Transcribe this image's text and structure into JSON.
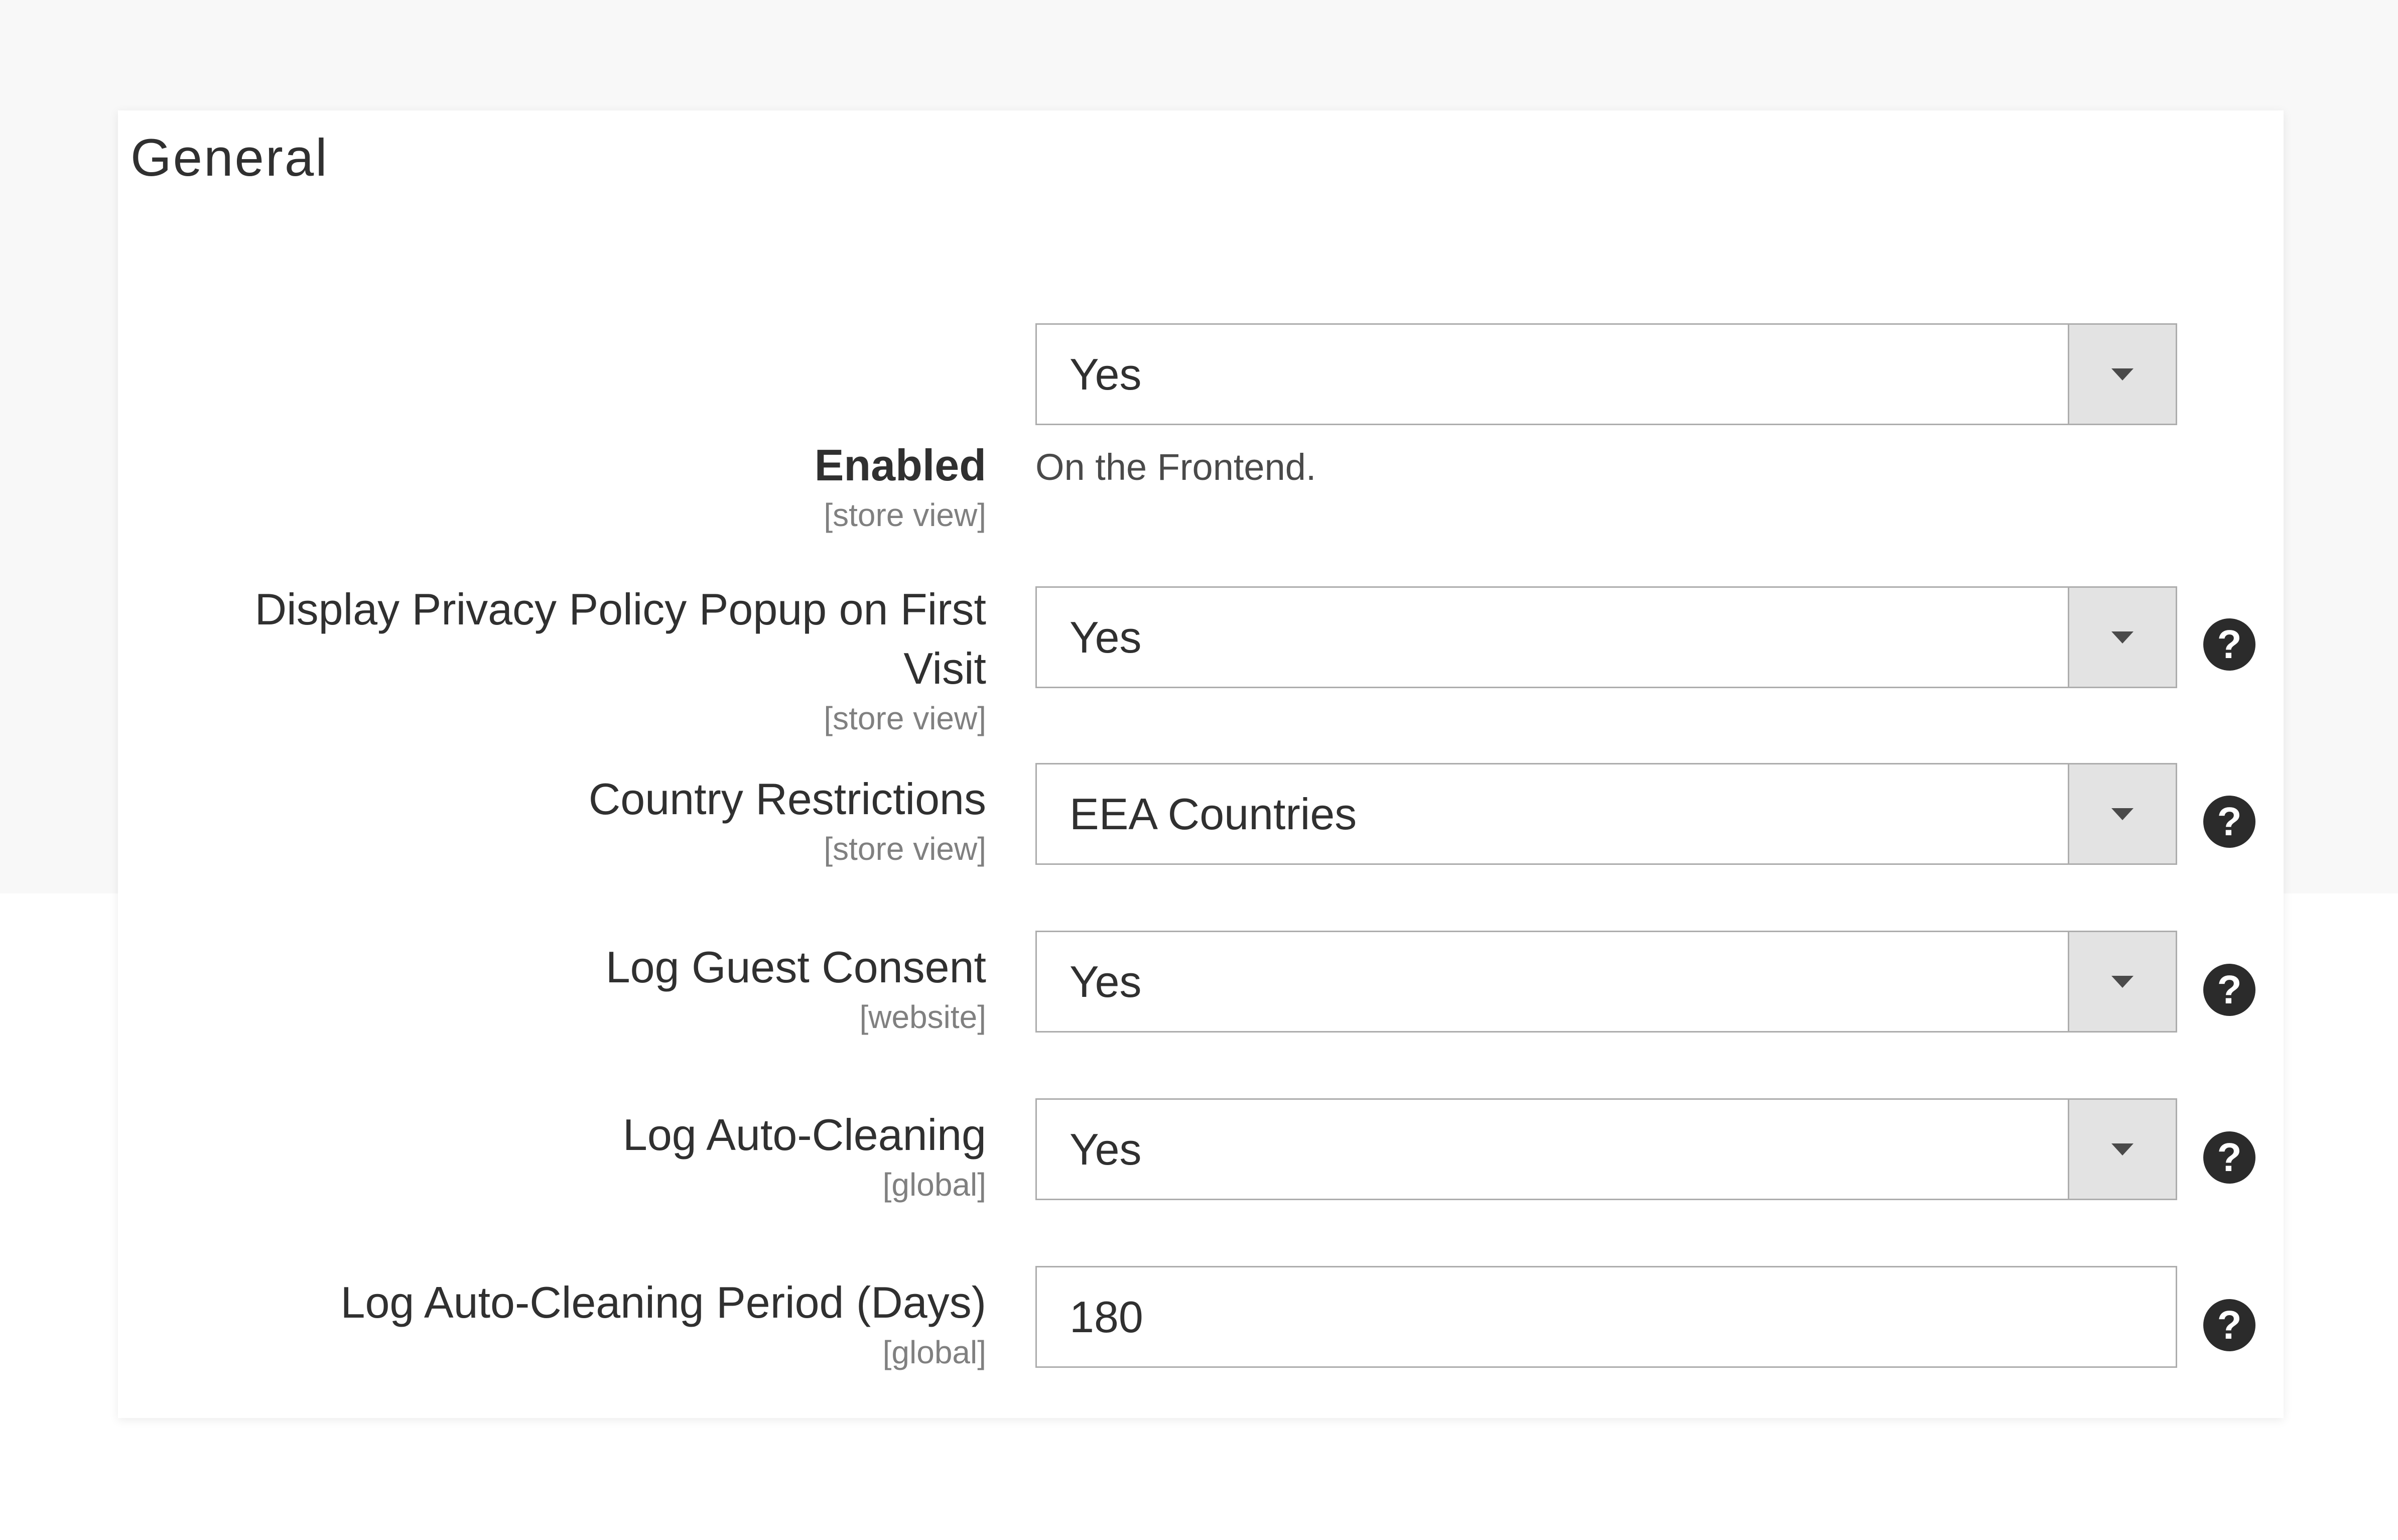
{
  "section": {
    "title": "General"
  },
  "fields": [
    {
      "label": "Enabled",
      "scope": "[store view]",
      "value": "Yes",
      "note": "On the Frontend.",
      "help": ""
    },
    {
      "label_line1": "Display Privacy Policy Popup on First",
      "label_line2": "Visit",
      "scope": "[store view]",
      "value": "Yes",
      "help": "?"
    },
    {
      "label": "Country Restrictions",
      "scope": "[store view]",
      "value": "EEA Countries",
      "help": "?"
    },
    {
      "label": "Log Guest Consent",
      "scope": "[website]",
      "value": "Yes",
      "help": "?"
    },
    {
      "label": "Log Auto-Cleaning",
      "scope": "[global]",
      "value": "Yes",
      "help": "?"
    },
    {
      "label": "Log Auto-Cleaning Period (Days)",
      "scope": "[global]",
      "value": "180",
      "help": "?"
    }
  ],
  "icons": {
    "dropdown": "chevron-down-icon",
    "help": "question-circle-icon"
  }
}
